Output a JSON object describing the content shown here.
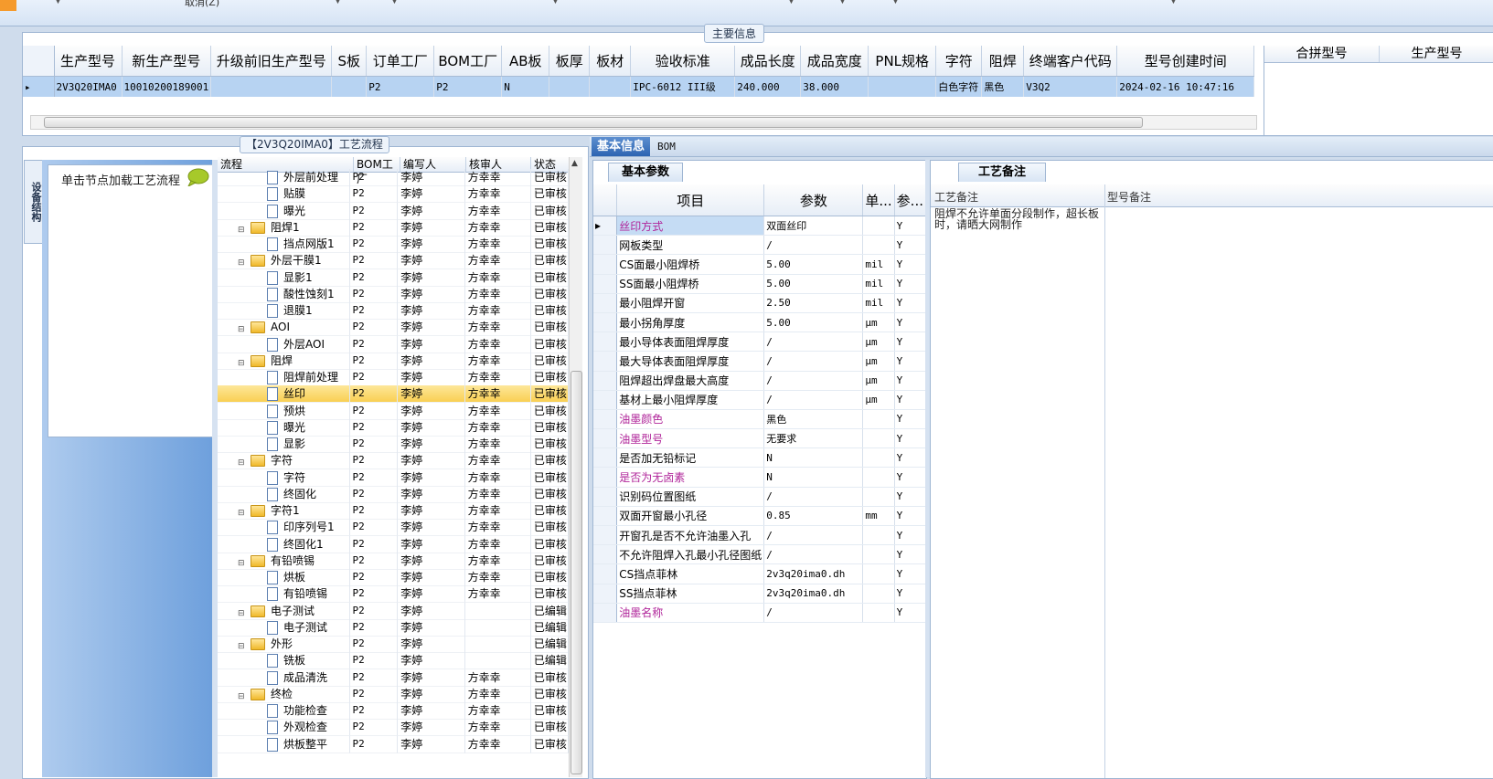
{
  "toolbar": {
    "cancel": "取消(Z)"
  },
  "main_info": {
    "title": "主要信息",
    "columns": [
      "生产型号",
      "新生产型号",
      "升级前旧生产型号",
      "S板",
      "订单工厂",
      "BOM工厂",
      "AB板",
      "板厚",
      "板材",
      "验收标准",
      "成品长度",
      "成品宽度",
      "PNL规格",
      "字符",
      "阻焊",
      "终端客户代码",
      "型号创建时间"
    ],
    "row": [
      "2V3Q20IMA0",
      "10010200189001",
      "",
      "",
      "P2",
      "P2",
      "N",
      "",
      "",
      "IPC-6012 III级",
      "240.000",
      "38.000",
      "",
      "白色字符",
      "黑色",
      "V3Q2",
      "2024-02-16 10:47:16"
    ],
    "right_columns": [
      "合拼型号",
      "生产型号"
    ]
  },
  "process": {
    "title": "【2V3Q20IMA0】工艺流程",
    "side_tab": "设备结构",
    "nav_hint": "单击节点加载工艺流程",
    "columns": [
      "流程",
      "BOM工厂",
      "编写人",
      "核审人",
      "状态"
    ],
    "rows": [
      {
        "name": "外层前处理",
        "bom": "P2",
        "writer": "李婷",
        "reviewer": "方幸幸",
        "status": "已审核",
        "level": 2
      },
      {
        "name": "贴膜",
        "bom": "P2",
        "writer": "李婷",
        "reviewer": "方幸幸",
        "status": "已审核",
        "level": 2
      },
      {
        "name": "曝光",
        "bom": "P2",
        "writer": "李婷",
        "reviewer": "方幸幸",
        "status": "已审核",
        "level": 2
      },
      {
        "name": "阻焊1",
        "bom": "P2",
        "writer": "李婷",
        "reviewer": "方幸幸",
        "status": "已审核",
        "level": 1
      },
      {
        "name": "挡点网版1",
        "bom": "P2",
        "writer": "李婷",
        "reviewer": "方幸幸",
        "status": "已审核",
        "level": 2
      },
      {
        "name": "外层干膜1",
        "bom": "P2",
        "writer": "李婷",
        "reviewer": "方幸幸",
        "status": "已审核",
        "level": 1
      },
      {
        "name": "显影1",
        "bom": "P2",
        "writer": "李婷",
        "reviewer": "方幸幸",
        "status": "已审核",
        "level": 2
      },
      {
        "name": "酸性蚀刻1",
        "bom": "P2",
        "writer": "李婷",
        "reviewer": "方幸幸",
        "status": "已审核",
        "level": 2
      },
      {
        "name": "退膜1",
        "bom": "P2",
        "writer": "李婷",
        "reviewer": "方幸幸",
        "status": "已审核",
        "level": 2
      },
      {
        "name": "AOI",
        "bom": "P2",
        "writer": "李婷",
        "reviewer": "方幸幸",
        "status": "已审核",
        "level": 1
      },
      {
        "name": "外层AOI",
        "bom": "P2",
        "writer": "李婷",
        "reviewer": "方幸幸",
        "status": "已审核",
        "level": 2
      },
      {
        "name": "阻焊",
        "bom": "P2",
        "writer": "李婷",
        "reviewer": "方幸幸",
        "status": "已审核",
        "level": 1
      },
      {
        "name": "阻焊前处理",
        "bom": "P2",
        "writer": "李婷",
        "reviewer": "方幸幸",
        "status": "已审核",
        "level": 2
      },
      {
        "name": "丝印",
        "bom": "P2",
        "writer": "李婷",
        "reviewer": "方幸幸",
        "status": "已审核",
        "level": 2,
        "selected": true
      },
      {
        "name": "预烘",
        "bom": "P2",
        "writer": "李婷",
        "reviewer": "方幸幸",
        "status": "已审核",
        "level": 2
      },
      {
        "name": "曝光",
        "bom": "P2",
        "writer": "李婷",
        "reviewer": "方幸幸",
        "status": "已审核",
        "level": 2
      },
      {
        "name": "显影",
        "bom": "P2",
        "writer": "李婷",
        "reviewer": "方幸幸",
        "status": "已审核",
        "level": 2
      },
      {
        "name": "字符",
        "bom": "P2",
        "writer": "李婷",
        "reviewer": "方幸幸",
        "status": "已审核",
        "level": 1
      },
      {
        "name": "字符",
        "bom": "P2",
        "writer": "李婷",
        "reviewer": "方幸幸",
        "status": "已审核",
        "level": 2
      },
      {
        "name": "终固化",
        "bom": "P2",
        "writer": "李婷",
        "reviewer": "方幸幸",
        "status": "已审核",
        "level": 2
      },
      {
        "name": "字符1",
        "bom": "P2",
        "writer": "李婷",
        "reviewer": "方幸幸",
        "status": "已审核",
        "level": 1
      },
      {
        "name": "印序列号1",
        "bom": "P2",
        "writer": "李婷",
        "reviewer": "方幸幸",
        "status": "已审核",
        "level": 2
      },
      {
        "name": "终固化1",
        "bom": "P2",
        "writer": "李婷",
        "reviewer": "方幸幸",
        "status": "已审核",
        "level": 2
      },
      {
        "name": "有铅喷锡",
        "bom": "P2",
        "writer": "李婷",
        "reviewer": "方幸幸",
        "status": "已审核",
        "level": 1
      },
      {
        "name": "烘板",
        "bom": "P2",
        "writer": "李婷",
        "reviewer": "方幸幸",
        "status": "已审核",
        "level": 2
      },
      {
        "name": "有铅喷锡",
        "bom": "P2",
        "writer": "李婷",
        "reviewer": "方幸幸",
        "status": "已审核",
        "level": 2
      },
      {
        "name": "电子测试",
        "bom": "P2",
        "writer": "李婷",
        "reviewer": "",
        "status": "已编辑",
        "level": 1
      },
      {
        "name": "电子测试",
        "bom": "P2",
        "writer": "李婷",
        "reviewer": "",
        "status": "已编辑",
        "level": 2
      },
      {
        "name": "外形",
        "bom": "P2",
        "writer": "李婷",
        "reviewer": "",
        "status": "已编辑",
        "level": 1
      },
      {
        "name": "铣板",
        "bom": "P2",
        "writer": "李婷",
        "reviewer": "",
        "status": "已编辑",
        "level": 2
      },
      {
        "name": "成品清洗",
        "bom": "P2",
        "writer": "李婷",
        "reviewer": "方幸幸",
        "status": "已审核",
        "level": 2
      },
      {
        "name": "终检",
        "bom": "P2",
        "writer": "李婷",
        "reviewer": "方幸幸",
        "status": "已审核",
        "level": 1
      },
      {
        "name": "功能检查",
        "bom": "P2",
        "writer": "李婷",
        "reviewer": "方幸幸",
        "status": "已审核",
        "level": 2
      },
      {
        "name": "外观检查",
        "bom": "P2",
        "writer": "李婷",
        "reviewer": "方幸幸",
        "status": "已审核",
        "level": 2
      },
      {
        "name": "烘板整平",
        "bom": "P2",
        "writer": "李婷",
        "reviewer": "方幸幸",
        "status": "已审核",
        "level": 2
      }
    ]
  },
  "right_tabs": {
    "basic": "基本信息",
    "bom": "BOM"
  },
  "basic_params": {
    "title": "基本参数",
    "columns": [
      "项目",
      "参数",
      "单...",
      "参..."
    ],
    "rows": [
      {
        "item": "丝印方式",
        "value": "双面丝印",
        "unit": "",
        "flag": "Y",
        "hl": true,
        "selected": true
      },
      {
        "item": "网板类型",
        "value": "/",
        "unit": "",
        "flag": "Y"
      },
      {
        "item": "CS面最小阻焊桥",
        "value": "5.00",
        "unit": "mil",
        "flag": "Y"
      },
      {
        "item": "SS面最小阻焊桥",
        "value": "5.00",
        "unit": "mil",
        "flag": "Y"
      },
      {
        "item": "最小阻焊开窗",
        "value": "2.50",
        "unit": "mil",
        "flag": "Y"
      },
      {
        "item": "最小拐角厚度",
        "value": "5.00",
        "unit": "μm",
        "flag": "Y"
      },
      {
        "item": "最小导体表面阻焊厚度",
        "value": "/",
        "unit": "μm",
        "flag": "Y"
      },
      {
        "item": "最大导体表面阻焊厚度",
        "value": "/",
        "unit": "μm",
        "flag": "Y"
      },
      {
        "item": "阻焊超出焊盘最大高度",
        "value": "/",
        "unit": "μm",
        "flag": "Y"
      },
      {
        "item": "基材上最小阻焊厚度",
        "value": "/",
        "unit": "μm",
        "flag": "Y"
      },
      {
        "item": "油墨颜色",
        "value": "黑色",
        "unit": "",
        "flag": "Y",
        "hl": true
      },
      {
        "item": "油墨型号",
        "value": "无要求",
        "unit": "",
        "flag": "Y",
        "hl": true
      },
      {
        "item": "是否加无铅标记",
        "value": "N",
        "unit": "",
        "flag": "Y"
      },
      {
        "item": "是否为无卤素",
        "value": "N",
        "unit": "",
        "flag": "Y",
        "hl": true
      },
      {
        "item": "识别码位置图纸",
        "value": "/",
        "unit": "",
        "flag": "Y"
      },
      {
        "item": "双面开窗最小孔径",
        "value": "0.85",
        "unit": "mm",
        "flag": "Y"
      },
      {
        "item": "开窗孔是否不允许油墨入孔",
        "value": "/",
        "unit": "",
        "flag": "Y"
      },
      {
        "item": "不允许阻焊入孔最小孔径图纸",
        "value": "/",
        "unit": "",
        "flag": "Y"
      },
      {
        "item": "CS挡点菲林",
        "value": "2v3q20ima0.dh",
        "unit": "",
        "flag": "Y"
      },
      {
        "item": "SS挡点菲林",
        "value": "2v3q20ima0.dh",
        "unit": "",
        "flag": "Y"
      },
      {
        "item": "油墨名称",
        "value": "/",
        "unit": "",
        "flag": "Y",
        "hl": true
      }
    ]
  },
  "remarks": {
    "title": "工艺备注",
    "col1": "工艺备注",
    "col2": "型号备注",
    "text": "阻焊不允许单面分段制作，超长板时，请晒大网制作"
  }
}
